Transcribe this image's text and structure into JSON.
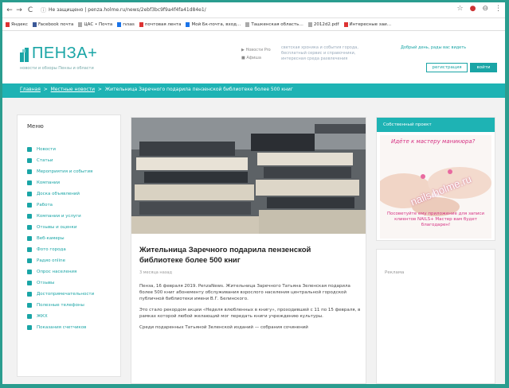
{
  "browser": {
    "url": "Не защищено | penza.holme.ru/news/2ebf3bc9f9a4f4fa41d84e1/",
    "bookmarks": [
      "Яндекс",
      "Facebook почта",
      "ЦАС • Почта",
      "rvsas",
      "почтовая лента",
      "Мой Бк-почта, вход…",
      "Ташкенская область…",
      "2012d2.pdf",
      "Интересные заи…"
    ]
  },
  "site": {
    "logo": "ПЕНЗА+",
    "logo_sub": "новости и обзоры Пензы и области",
    "link_a": "Новости Pro",
    "link_b": "Афиша",
    "header_desc": "светская хроника и события города, бесплатный сервис и справочники, интересная среда развлечения",
    "greeting": "Добрый день, рады вас видеть",
    "register": "регистрация",
    "login": "войти"
  },
  "breadcrumb": {
    "home": "Главная",
    "sep": ">",
    "section": "Местные новости",
    "current": "Жительница Заречного подарила пензенской библиотеке более 500 книг"
  },
  "menu": {
    "title": "Меню",
    "items": [
      "Новости",
      "Статьи",
      "Мероприятия и события",
      "Компании",
      "Доска объявлений",
      "Работа",
      "Компании и услуги",
      "Отзывы и оценки",
      "Веб-камеры",
      "Фото города",
      "Радио online",
      "Опрос населения",
      "Отзывы",
      "Достопримечательности",
      "Полезные телефоны",
      "ЖКХ",
      "Показания счетчиков"
    ]
  },
  "article": {
    "title": "Жительница Заречного подарила пензенской библиотеке более 500 книг",
    "date": "3 месяца назад",
    "p1": "Пенза, 16 февраля 2019. PenzaNews. Жительница Заречного Татьяна Зеленская подарила более 500 книг абонементу обслуживания взрослого населения центральной городской публичной библиотеки имени В.Г. Белинского.",
    "p2": "Это стало рекордом акции «Неделя влюбленных в книгу», проходившей с 11 по 15 февраля, в рамках которой любой желающий мог передать книги учреждению культуры.",
    "p3": "Среди подаренных Татьяной Зеленской изданий — собрания сочинений"
  },
  "promo": {
    "header": "Собственный проект",
    "line1": "Идёте к мастеру маникюра?",
    "brand": "nails.holme.ru",
    "line2": "Посоветуйте ему приложение для записи клиентов NAILS+ Мастер вам будет благодарен!"
  },
  "ads": {
    "title": "Реклама"
  }
}
